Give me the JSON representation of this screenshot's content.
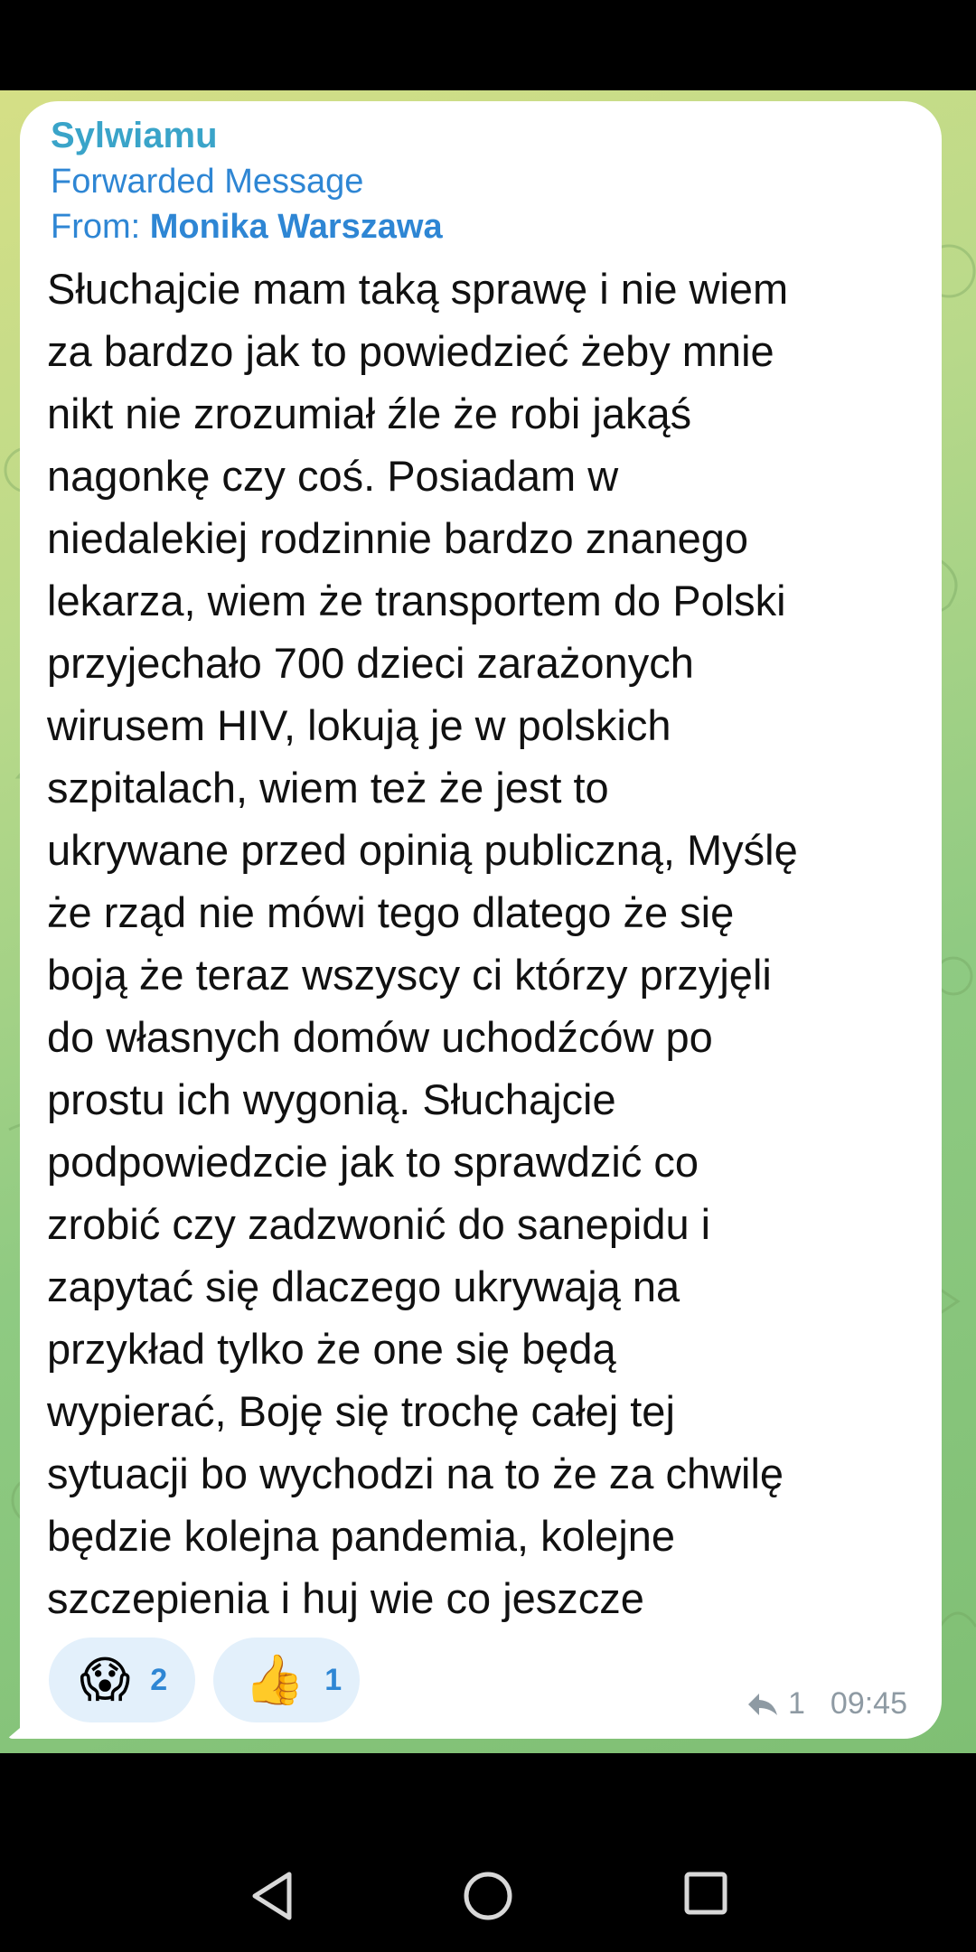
{
  "message": {
    "sender": "Sylwiamu",
    "forward_label": "Forwarded Message",
    "forward_from_prefix": "From:",
    "forward_from_name": "Monika Warszawa",
    "text": "Słuchajcie mam taką sprawę i nie wiem\nza bardzo jak to powiedzieć żeby mnie\nnikt nie zrozumiał źle że robi jakąś\nnagonkę czy coś. Posiadam w\nniedalekiej rodzinnie bardzo znanego\nlekarza, wiem że transportem do Polski\nprzyjechało 700 dzieci zarażonych\nwirusem HIV, lokują je w polskich\nszpitalach, wiem też że jest to\nukrywane przed opinią publiczną, Myślę\nże rząd nie mówi tego dlatego że się\nboją że teraz wszyscy ci którzy przyjęli\ndo własnych domów uchodźców po\nprostu ich wygonią. Słuchajcie\npodpowiedzcie jak to sprawdzić co\nzrobić czy zadzwonić do sanepidu i\nzapytać się dlaczego ukrywają na\nprzykład tylko że one się będą\nwypierać, Boję się trochę całej tej\nsytuacji bo wychodzi na to że za chwilę\nbędzie kolejna pandemia, kolejne\nszczepienia i huj wie co jeszcze",
    "reactions": [
      {
        "emoji": "😱",
        "count": "2",
        "icon": "screaming-face-icon"
      },
      {
        "emoji": "👍",
        "count": "1",
        "icon": "thumbs-up-icon"
      }
    ],
    "forwards_count": "1",
    "time": "09:45"
  },
  "colors": {
    "sender": "#3aa4c9",
    "link_blue": "#2e86d4",
    "reaction_bg": "#e3f0fb",
    "meta_grey": "#8e9aa3"
  }
}
